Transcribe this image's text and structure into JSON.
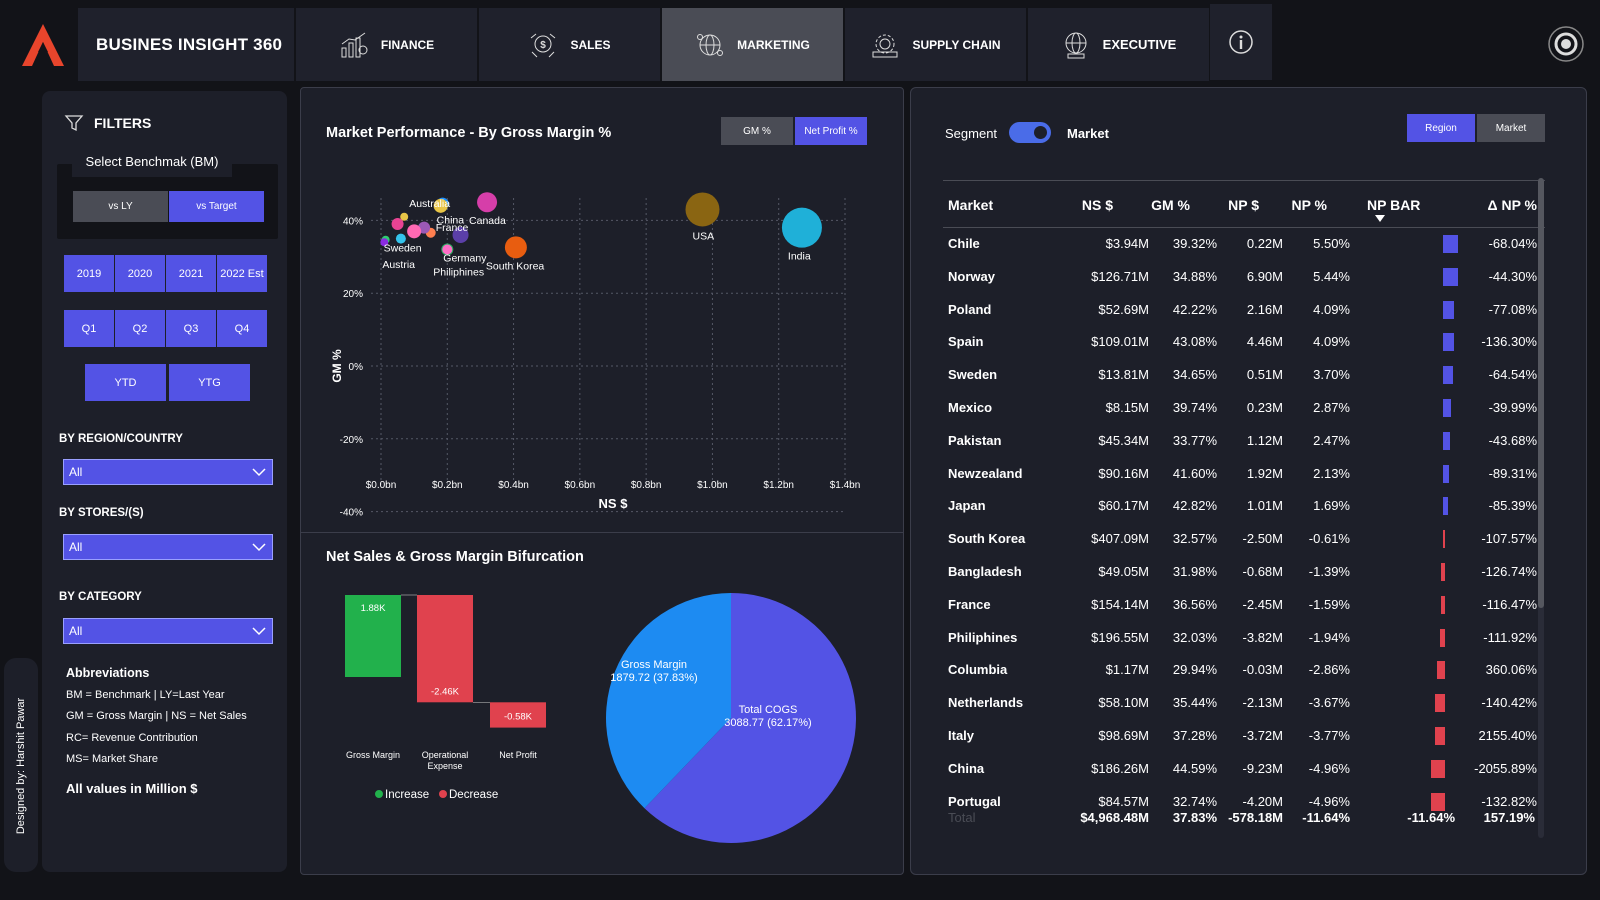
{
  "app": {
    "title": "BUSINES INSIGHT 360"
  },
  "nav": [
    {
      "label": "FINANCE",
      "icon": "finance-chart-icon",
      "active": false
    },
    {
      "label": "SALES",
      "icon": "sales-badge-icon",
      "active": false
    },
    {
      "label": "MARKETING",
      "icon": "marketing-globe-icon",
      "active": true
    },
    {
      "label": "SUPPLY CHAIN",
      "icon": "supply-chain-icon",
      "active": false
    },
    {
      "label": "EXECUTIVE",
      "icon": "executive-globe-icon",
      "active": false
    }
  ],
  "sidebar": {
    "filters_title": "FILTERS",
    "benchmark_label": "Select Benchmak (BM)",
    "bm_options": [
      "vs LY",
      "vs Target"
    ],
    "bm_selected": "vs Target",
    "years": [
      "2019",
      "2020",
      "2021",
      "2022 Est"
    ],
    "quarters": [
      "Q1",
      "Q2",
      "Q3",
      "Q4"
    ],
    "periods": [
      "YTD",
      "YTG"
    ],
    "region_label": "BY REGION/COUNTRY",
    "region_value": "All",
    "stores_label": "BY STORES/(S)",
    "stores_value": "All",
    "category_label": "BY CATEGORY",
    "category_value": "All",
    "abbr_title": "Abbreviations",
    "abbr_lines": [
      "BM = Benchmark | LY=Last Year",
      "GM = Gross Margin | NS = Net Sales",
      "RC= Revenue Contribution",
      "MS= Market Share"
    ],
    "all_values_note": "All values in Million $",
    "designed_by": "Designed by: Harshit Pawar"
  },
  "scatter": {
    "title": "Market Performance - By Gross Margin %",
    "toggle": [
      "GM %",
      "Net Profit %"
    ],
    "toggle_selected": "Net Profit %"
  },
  "waterfall": {
    "title": "Net Sales & Gross Margin Bifurcation",
    "legend_increase": "Increase",
    "legend_decrease": "Decrease"
  },
  "pie": {},
  "right_panel": {
    "segment_label": "Segment",
    "market_label": "Market",
    "view_buttons": [
      "Region",
      "Market"
    ],
    "view_selected": "Region",
    "columns": [
      "Market",
      "NS $",
      "GM %",
      "NP $",
      "NP %",
      "NP BAR",
      "Δ NP %"
    ],
    "rows": [
      {
        "market": "Chile",
        "ns": "$3.94M",
        "gm": "39.32%",
        "np": "0.22M",
        "npp": "5.50%",
        "np_pct": 5.5,
        "dnp": "-68.04%"
      },
      {
        "market": "Norway",
        "ns": "$126.71M",
        "gm": "34.88%",
        "np": "6.90M",
        "npp": "5.44%",
        "np_pct": 5.44,
        "dnp": "-44.30%"
      },
      {
        "market": "Poland",
        "ns": "$52.69M",
        "gm": "42.22%",
        "np": "2.16M",
        "npp": "4.09%",
        "np_pct": 4.09,
        "dnp": "-77.08%"
      },
      {
        "market": "Spain",
        "ns": "$109.01M",
        "gm": "43.08%",
        "np": "4.46M",
        "npp": "4.09%",
        "np_pct": 4.09,
        "dnp": "-136.30%"
      },
      {
        "market": "Sweden",
        "ns": "$13.81M",
        "gm": "34.65%",
        "np": "0.51M",
        "npp": "3.70%",
        "np_pct": 3.7,
        "dnp": "-64.54%"
      },
      {
        "market": "Mexico",
        "ns": "$8.15M",
        "gm": "39.74%",
        "np": "0.23M",
        "npp": "2.87%",
        "np_pct": 2.87,
        "dnp": "-39.99%"
      },
      {
        "market": "Pakistan",
        "ns": "$45.34M",
        "gm": "33.77%",
        "np": "1.12M",
        "npp": "2.47%",
        "np_pct": 2.47,
        "dnp": "-43.68%"
      },
      {
        "market": "Newzealand",
        "ns": "$90.16M",
        "gm": "41.60%",
        "np": "1.92M",
        "npp": "2.13%",
        "np_pct": 2.13,
        "dnp": "-89.31%"
      },
      {
        "market": "Japan",
        "ns": "$60.17M",
        "gm": "42.82%",
        "np": "1.01M",
        "npp": "1.69%",
        "np_pct": 1.69,
        "dnp": "-85.39%"
      },
      {
        "market": "South Korea",
        "ns": "$407.09M",
        "gm": "32.57%",
        "np": "-2.50M",
        "npp": "-0.61%",
        "np_pct": -0.61,
        "dnp": "-107.57%"
      },
      {
        "market": "Bangladesh",
        "ns": "$49.05M",
        "gm": "31.98%",
        "np": "-0.68M",
        "npp": "-1.39%",
        "np_pct": -1.39,
        "dnp": "-126.74%"
      },
      {
        "market": "France",
        "ns": "$154.14M",
        "gm": "36.56%",
        "np": "-2.45M",
        "npp": "-1.59%",
        "np_pct": -1.59,
        "dnp": "-116.47%"
      },
      {
        "market": "Philiphines",
        "ns": "$196.55M",
        "gm": "32.03%",
        "np": "-3.82M",
        "npp": "-1.94%",
        "np_pct": -1.94,
        "dnp": "-111.92%"
      },
      {
        "market": "Columbia",
        "ns": "$1.17M",
        "gm": "29.94%",
        "np": "-0.03M",
        "npp": "-2.86%",
        "np_pct": -2.86,
        "dnp": "360.06%"
      },
      {
        "market": "Netherlands",
        "ns": "$58.10M",
        "gm": "35.44%",
        "np": "-2.13M",
        "npp": "-3.67%",
        "np_pct": -3.67,
        "dnp": "-140.42%"
      },
      {
        "market": "Italy",
        "ns": "$98.69M",
        "gm": "37.28%",
        "np": "-3.72M",
        "npp": "-3.77%",
        "np_pct": -3.77,
        "dnp": "2155.40%"
      },
      {
        "market": "China",
        "ns": "$186.26M",
        "gm": "44.59%",
        "np": "-9.23M",
        "npp": "-4.96%",
        "np_pct": -4.96,
        "dnp": "-2055.89%"
      },
      {
        "market": "Portugal",
        "ns": "$84.57M",
        "gm": "32.74%",
        "np": "-4.20M",
        "npp": "-4.96%",
        "np_pct": -4.96,
        "dnp": "-132.82%"
      }
    ],
    "total": {
      "label": "Total",
      "ns": "$4,968.48M",
      "gm": "37.83%",
      "np": "-578.18M",
      "npp": "-11.64%",
      "npbar": "-11.64%",
      "dnp": "157.19%"
    }
  },
  "colors": {
    "accent": "#5353e5",
    "positive_bar": "#5353e5",
    "negative_bar": "#e0424e",
    "increase": "#22b14c",
    "decrease": "#e0424e",
    "panel_bg": "#1d1f29",
    "page_bg": "#121318"
  },
  "chart_data": [
    {
      "type": "scatter",
      "title": "Market Performance - By Gross Margin %",
      "xlabel": "NS $",
      "ylabel": "GM %",
      "xlim": [
        0,
        1.4
      ],
      "ylim": [
        -50,
        50
      ],
      "x_ticks": [
        "$0.0bn",
        "$0.2bn",
        "$0.4bn",
        "$0.6bn",
        "$0.8bn",
        "$1.0bn",
        "$1.2bn",
        "$1.4bn"
      ],
      "y_ticks": [
        "40%",
        "20%",
        "0%",
        "-20%",
        "-40%"
      ],
      "grid": true,
      "points": [
        {
          "label": "Australia",
          "x": 0.07,
          "y": 41,
          "r": 4,
          "color": "#e8c547"
        },
        {
          "label": "France",
          "x": 0.15,
          "y": 36.6,
          "r": 5,
          "color": "#ff7f50"
        },
        {
          "label": "Sweden",
          "x": 0.014,
          "y": 34.7,
          "r": 4,
          "color": "#2ecc71"
        },
        {
          "label": "Austria",
          "x": 0.01,
          "y": 34,
          "r": 4,
          "color": "#8a2be2"
        },
        {
          "label": "Germany",
          "x": 0.2,
          "y": 32,
          "r": 6,
          "color": "#27ae60"
        },
        {
          "label": "Philiphines",
          "x": 0.2,
          "y": 32,
          "r": 5,
          "color": "#ff6ec7"
        },
        {
          "label": "China",
          "x": 0.186,
          "y": 44.6,
          "r": 6,
          "color": "#1e90ff"
        },
        {
          "label": "",
          "x": 0.18,
          "y": 44,
          "r": 7,
          "color": "#e8c547"
        },
        {
          "label": "",
          "x": 0.24,
          "y": 36,
          "r": 8,
          "color": "#5b3fa8"
        },
        {
          "label": "",
          "x": 0.05,
          "y": 39,
          "r": 6,
          "color": "#e84393"
        },
        {
          "label": "",
          "x": 0.13,
          "y": 38,
          "r": 6,
          "color": "#9b59b6"
        },
        {
          "label": "",
          "x": 0.1,
          "y": 37,
          "r": 7,
          "color": "#ff69b4"
        },
        {
          "label": "",
          "x": 0.06,
          "y": 35,
          "r": 5,
          "color": "#34c3eb"
        },
        {
          "label": "Canada",
          "x": 0.32,
          "y": 45,
          "r": 10,
          "color": "#d63ea9"
        },
        {
          "label": "South Korea",
          "x": 0.407,
          "y": 32.6,
          "r": 11,
          "color": "#e85d10"
        },
        {
          "label": "USA",
          "x": 0.97,
          "y": 43,
          "r": 17,
          "color": "#8a6512"
        },
        {
          "label": "India",
          "x": 1.27,
          "y": 38,
          "r": 20,
          "color": "#1fb0d8"
        }
      ]
    },
    {
      "type": "bar",
      "subtype": "waterfall",
      "title": "Net Sales & Gross Margin Bifurcation",
      "categories": [
        "Gross Margin",
        "Operational Expense",
        "Net Profit"
      ],
      "values": [
        1.88,
        -2.46,
        -0.58
      ],
      "data_labels": [
        "1.88K",
        "-2.46K",
        "-0.58K"
      ],
      "legend": [
        "Increase",
        "Decrease"
      ]
    },
    {
      "type": "pie",
      "labels": [
        "Gross Margin",
        "Total COGS"
      ],
      "values": [
        1879.72,
        3088.77
      ],
      "percent_labels": [
        "1879.72 (37.83%)",
        "3088.77 (62.17%)"
      ],
      "colors": [
        "#1d8bf2",
        "#5353e5"
      ]
    }
  ]
}
